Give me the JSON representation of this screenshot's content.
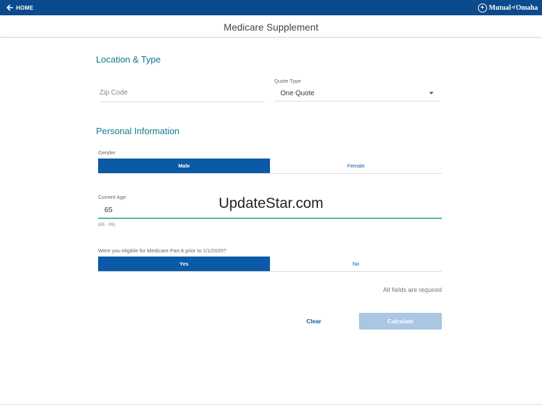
{
  "topbar": {
    "home_label": "HOME",
    "brand_text": "Mutual",
    "brand_of": "of",
    "brand_suffix": "Omaha",
    "color": "#0b4a8c"
  },
  "header": {
    "title": "Medicare Supplement"
  },
  "location": {
    "section_title": "Location & Type",
    "zip_placeholder": "Zip Code",
    "zip_value": "",
    "quote_type_label": "Quote Type",
    "quote_type_value": "One Quote"
  },
  "personal": {
    "section_title": "Personal Information",
    "gender_label": "Gender",
    "gender_options": [
      "Male",
      "Female"
    ],
    "gender_selected": "Male",
    "age_label": "Current Age",
    "age_value": "65",
    "age_range": "(65 - 99)",
    "eligibility_question": "Were you eligible for Medicare Part A prior to 1/1/2020?",
    "eligibility_options": [
      "Yes",
      "No"
    ],
    "eligibility_selected": "Yes"
  },
  "footer": {
    "required_note": "All fields are required",
    "clear_label": "Clear",
    "calculate_label": "Calculate"
  },
  "watermark": "UpdateStar.com",
  "colors": {
    "accent": "#0b5aa8",
    "section_title": "#12798c",
    "focus_underline": "#4fb6a8",
    "disabled_button": "#a9c6e3"
  }
}
